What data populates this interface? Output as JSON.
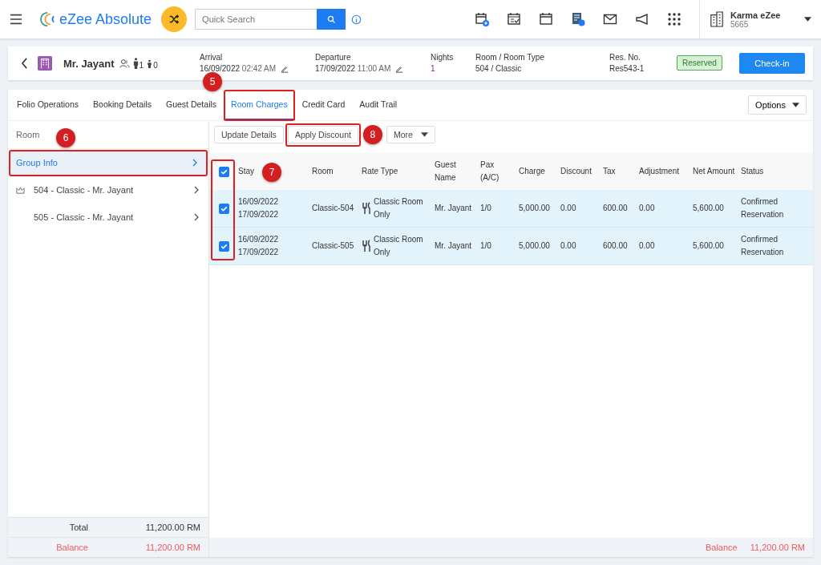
{
  "topbar": {
    "brand": "eZee Absolute",
    "search": {
      "placeholder": "Quick Search"
    },
    "property": {
      "name": "Karma eZee",
      "code": "5665"
    }
  },
  "booking": {
    "guest": "Mr. Jayant",
    "adults": "1",
    "children": "0",
    "fields": [
      {
        "label": "Arrival",
        "date": "16/09/2022",
        "time": "02:42 AM",
        "editable": true
      },
      {
        "label": "Departure",
        "date": "17/09/2022",
        "time": "11:00 AM",
        "editable": true
      },
      {
        "label": "Nights",
        "value": "1",
        "editable": false
      },
      {
        "label": "Room / Room Type",
        "value": "504 / Classic",
        "editable": false
      },
      {
        "label": "Res. No.",
        "value": "Res543-1",
        "editable": false
      }
    ],
    "status": "Reserved",
    "action": "Check-in"
  },
  "tabs": [
    {
      "label": "Folio Operations",
      "selected": false
    },
    {
      "label": "Booking Details",
      "selected": false
    },
    {
      "label": "Guest Details",
      "selected": false
    },
    {
      "label": "Room Charges",
      "selected": true,
      "callout": "5"
    },
    {
      "label": "Credit Card",
      "selected": false
    },
    {
      "label": "Audit Trail",
      "selected": false
    }
  ],
  "options_button": "Options",
  "sidebar": {
    "heading": "Room",
    "items": [
      {
        "label": "Group Info",
        "selected": true,
        "icon": false,
        "callout": "6"
      },
      {
        "label": "504 - Classic - Mr. Jayant",
        "selected": false,
        "icon": true
      },
      {
        "label": "505 - Classic - Mr. Jayant",
        "selected": false,
        "icon": false
      }
    ],
    "total_label": "Total",
    "total": "11,200.00 RM",
    "balance_label": "Balance",
    "balance": "11,200.00 RM"
  },
  "toolbar": [
    {
      "label": "Update Details",
      "dropdown": false
    },
    {
      "label": "Apply Discount",
      "dropdown": false,
      "callout": "8"
    },
    {
      "label": "More",
      "dropdown": true
    }
  ],
  "table": {
    "all_checked": true,
    "checkbox_callout": "7",
    "columns": [
      "Stay",
      "Room",
      "Rate Type",
      "Guest Name",
      "Pax (A/C)",
      "Charge",
      "Discount",
      "Tax",
      "Adjustment",
      "Net Amount",
      "Status"
    ],
    "rows": [
      {
        "selected": true,
        "cells": [
          "16/09/2022 17/09/2022",
          "Classic-504",
          "Classic Room Only",
          "Mr. Jayant",
          "1/0",
          "5,000.00",
          "0.00",
          "600.00",
          "0.00",
          "5,600.00",
          "Confirmed Reservation"
        ]
      },
      {
        "selected": true,
        "cells": [
          "16/09/2022 17/09/2022",
          "Classic-505",
          "Classic Room Only",
          "Mr. Jayant",
          "1/0",
          "5,000.00",
          "0.00",
          "600.00",
          "0.00",
          "5,600.00",
          "Confirmed Reservation"
        ]
      }
    ],
    "balance_label": "Balance",
    "balance": "11,200.00 RM"
  }
}
